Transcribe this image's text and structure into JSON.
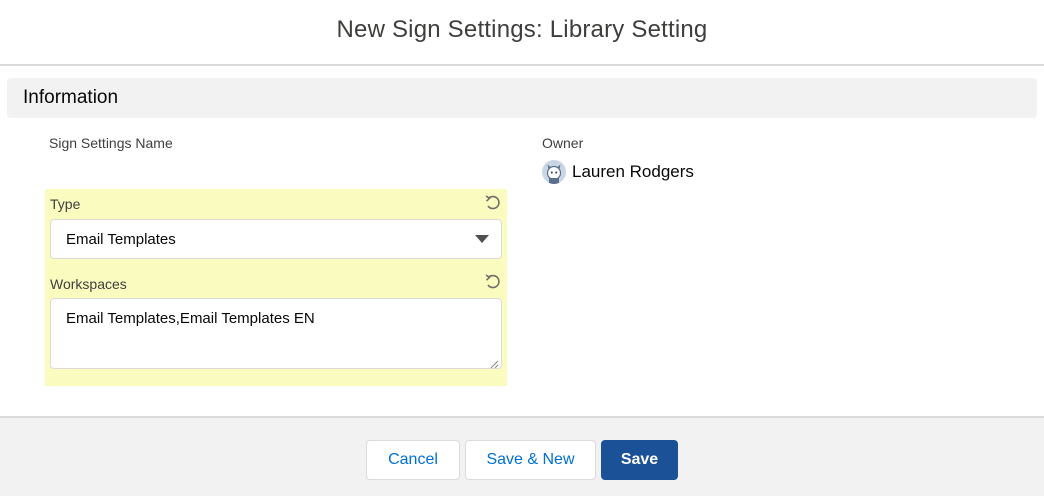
{
  "modal": {
    "title": "New Sign Settings: Library Setting"
  },
  "section": {
    "title": "Information"
  },
  "fields": {
    "name_label": "Sign Settings Name",
    "owner_label": "Owner",
    "owner_name": "Lauren Rodgers",
    "owner_avatar_icon": "user-avatar-icon",
    "type_label": "Type",
    "type_value": "Email Templates",
    "workspaces_label": "Workspaces",
    "workspaces_value": "Email Templates,Email Templates EN"
  },
  "footer": {
    "cancel_label": "Cancel",
    "save_new_label": "Save & New",
    "save_label": "Save"
  },
  "colors": {
    "edited_highlight": "#fafcbf",
    "brand_button": "#1b5297",
    "link_text": "#0070d2",
    "section_bg": "#f3f2f2"
  }
}
